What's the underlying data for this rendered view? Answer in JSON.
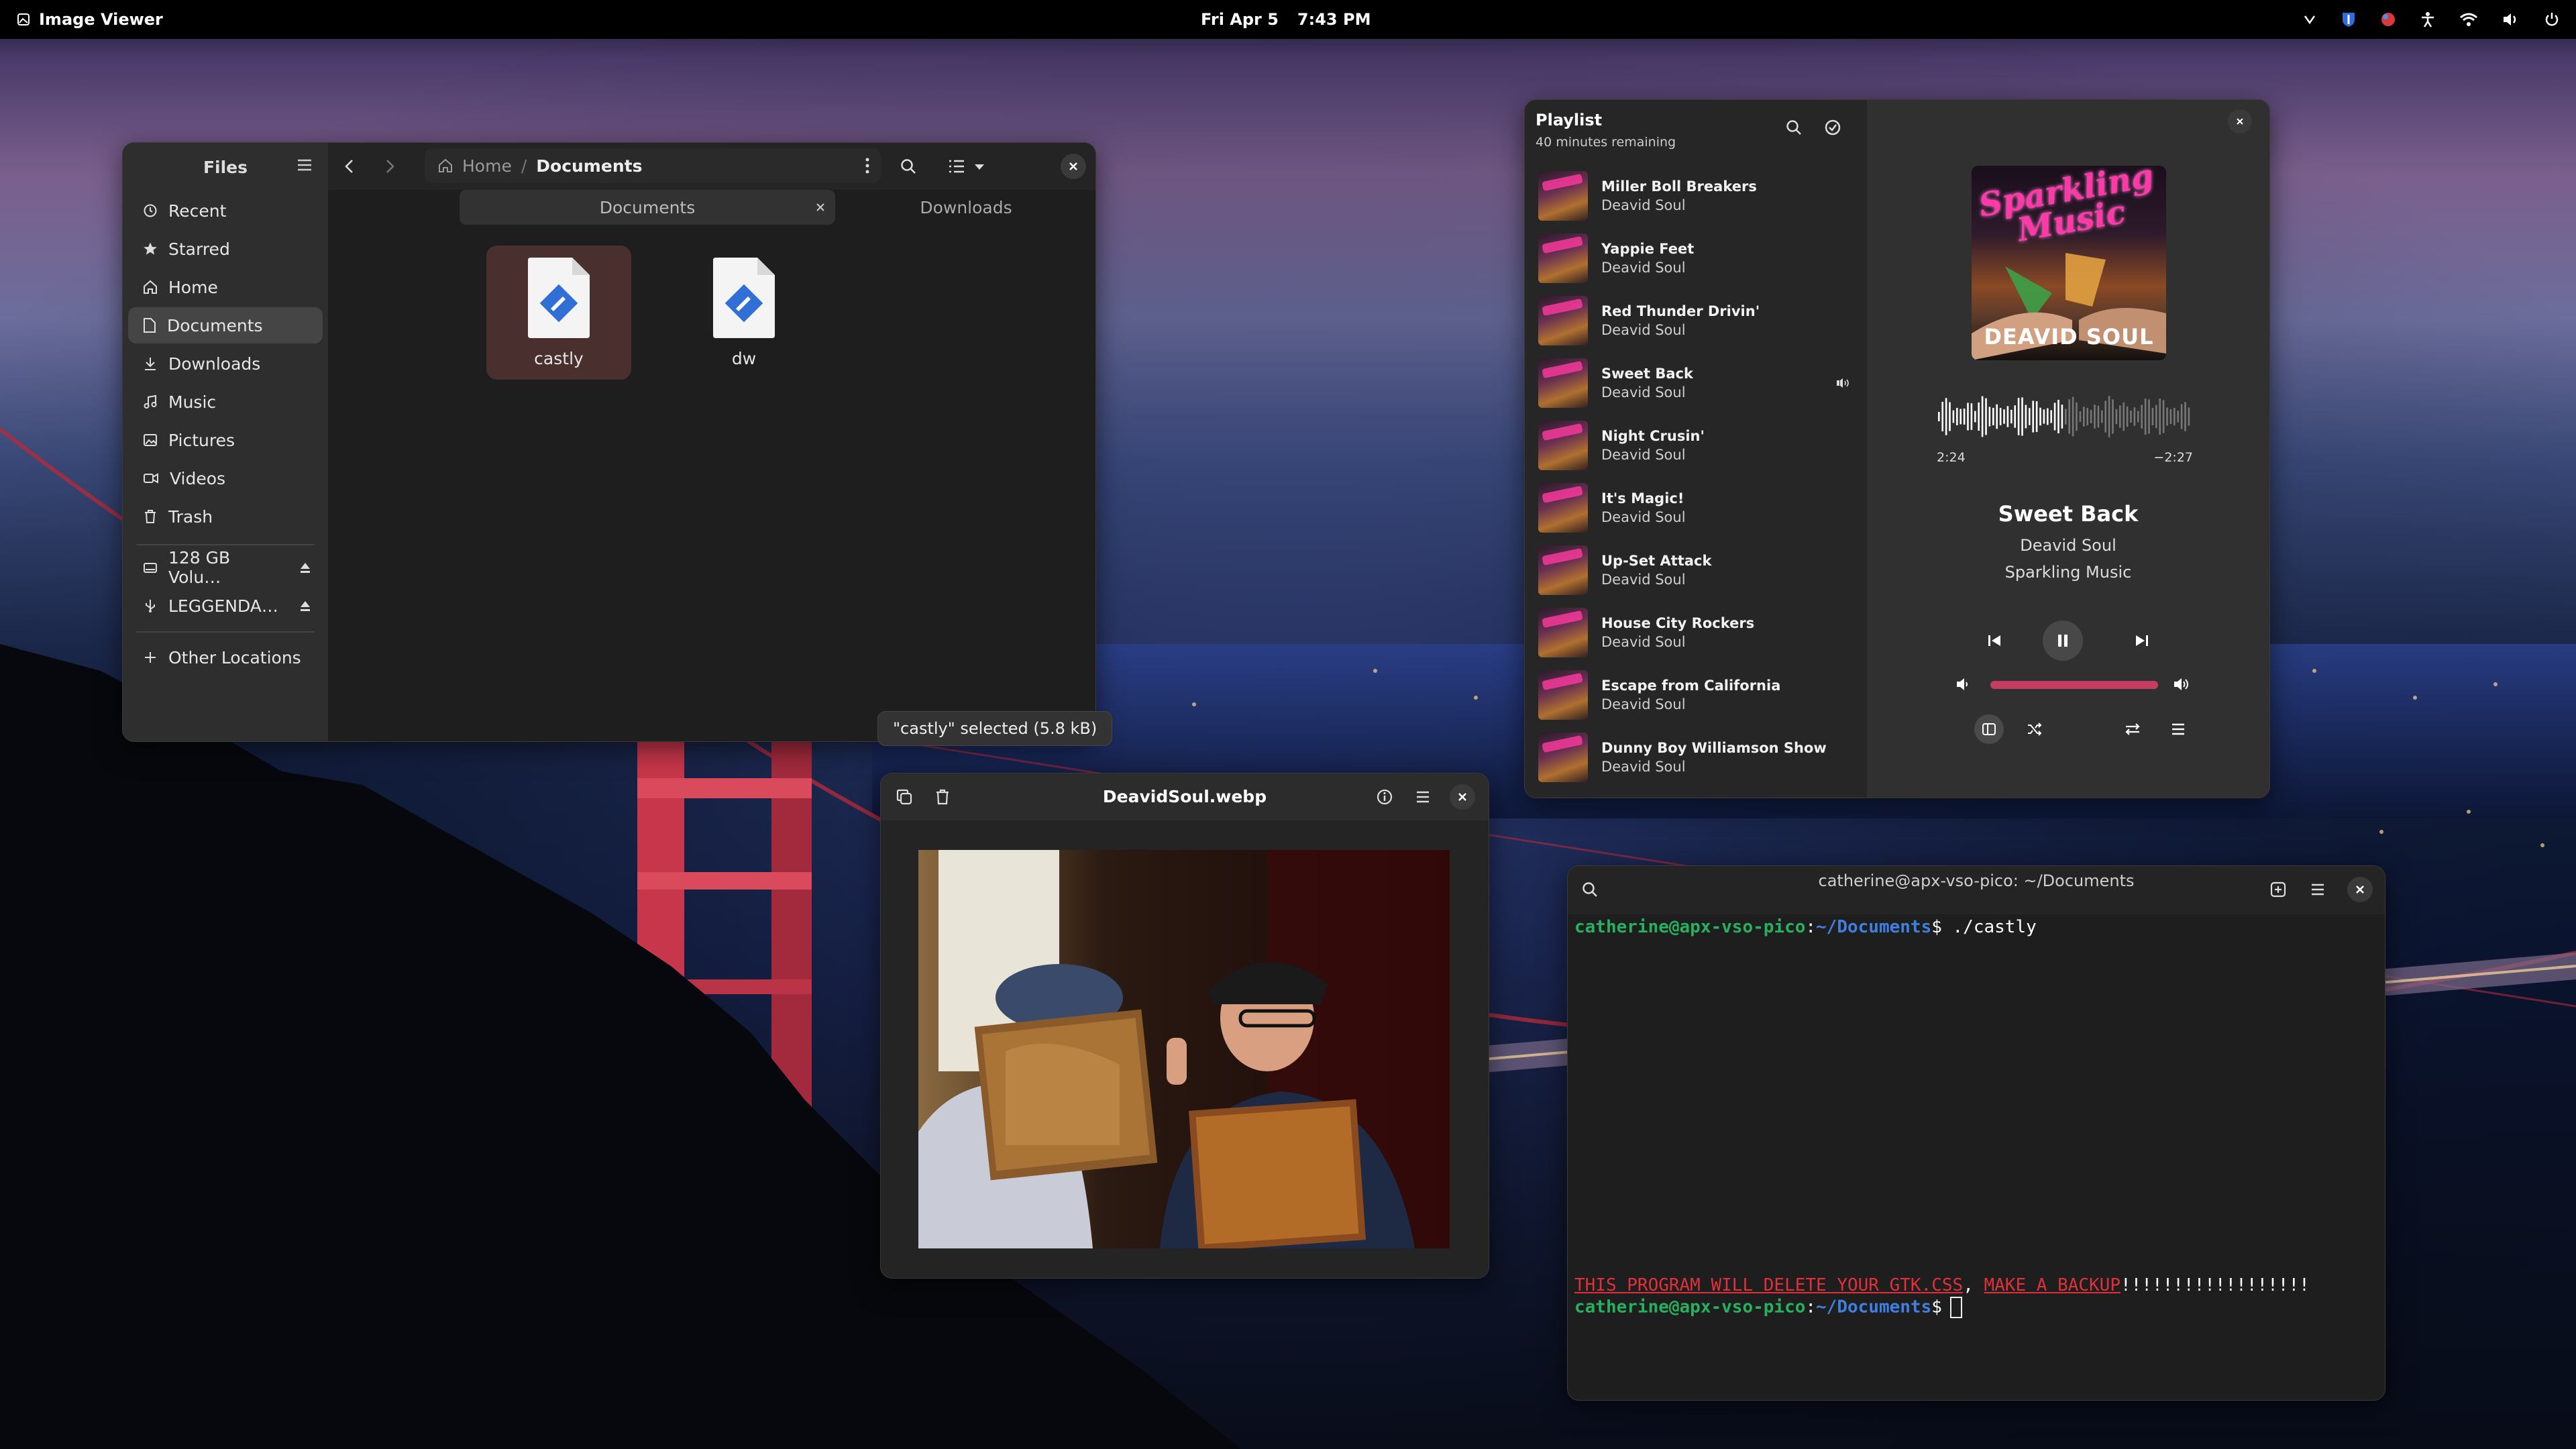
{
  "topbar": {
    "app_name": "Image Viewer",
    "date": "Fri Apr 5",
    "time": "7:43 PM",
    "tray_icons": [
      "keyboard-icon",
      "bitwarden-icon",
      "record-icon",
      "accessibility-icon",
      "wifi-icon",
      "volume-icon",
      "power-icon"
    ]
  },
  "files": {
    "title": "Files",
    "sidebar": [
      {
        "label": "Recent",
        "icon": "clock-icon"
      },
      {
        "label": "Starred",
        "icon": "star-icon"
      },
      {
        "label": "Home",
        "icon": "home-icon"
      },
      {
        "label": "Documents",
        "icon": "document-icon",
        "active": true
      },
      {
        "label": "Downloads",
        "icon": "download-icon"
      },
      {
        "label": "Music",
        "icon": "music-icon"
      },
      {
        "label": "Pictures",
        "icon": "picture-icon"
      },
      {
        "label": "Videos",
        "icon": "video-icon"
      },
      {
        "label": "Trash",
        "icon": "trash-icon"
      }
    ],
    "volumes": [
      {
        "label": "128 GB Volu…",
        "icon": "drive-icon"
      },
      {
        "label": "LEGGENDA…",
        "icon": "usb-icon"
      }
    ],
    "other_locations": "Other Locations",
    "breadcrumb": {
      "home": "Home",
      "separator": "/",
      "current": "Documents"
    },
    "tabs": [
      "Documents",
      "Downloads"
    ],
    "items": [
      {
        "name": "castly",
        "selected": true
      },
      {
        "name": "dw",
        "selected": false
      }
    ],
    "status": "\"castly\" selected  (5.8 kB)"
  },
  "music": {
    "playlist_title": "Playlist",
    "remaining": "40 minutes remaining",
    "tracks": [
      {
        "title": "Miller Boll Breakers",
        "artist": "Deavid Soul"
      },
      {
        "title": "Yappie Feet",
        "artist": "Deavid Soul"
      },
      {
        "title": "Red Thunder Drivin'",
        "artist": "Deavid Soul"
      },
      {
        "title": "Sweet Back",
        "artist": "Deavid Soul",
        "playing": true
      },
      {
        "title": "Night Crusin'",
        "artist": "Deavid Soul"
      },
      {
        "title": "It's Magic!",
        "artist": "Deavid Soul"
      },
      {
        "title": "Up-Set Attack",
        "artist": "Deavid Soul"
      },
      {
        "title": "House City Rockers",
        "artist": "Deavid Soul"
      },
      {
        "title": "Escape from California",
        "artist": "Deavid Soul"
      },
      {
        "title": "Dunny Boy Williamson Show",
        "artist": "Deavid Soul"
      }
    ],
    "now_playing": {
      "title": "Sweet Back",
      "artist": "Deavid Soul",
      "album": "Sparkling Music",
      "elapsed": "2:24",
      "remaining": "−2:27",
      "progress": 0.5,
      "volume": 1.0
    },
    "cover_text": {
      "top": "Sparkling",
      "bottom": "Music",
      "artist": "DEAVID SOUL"
    }
  },
  "viewer": {
    "filename": "DeavidSoul.webp"
  },
  "terminal": {
    "title": "catherine@apx-vso-pico: ~/Documents",
    "user_host": "catherine@apx-vso-pico",
    "path": "~/Documents",
    "command1": " ./castly",
    "warning_part1": "THIS PROGRAM WILL DELETE YOUR GTK.CSS",
    "warning_sep": ", ",
    "warning_part2": "MAKE A BACKUP",
    "warning_bangs": "!!!!!!!!!!!!!!!!!!",
    "prompt_colon": ":",
    "prompt_dollar": "$"
  },
  "colors": {
    "accent": "#c53d5f",
    "terminal_green": "#26b15f",
    "terminal_blue": "#3f7fe0",
    "terminal_red": "#e0303a"
  }
}
